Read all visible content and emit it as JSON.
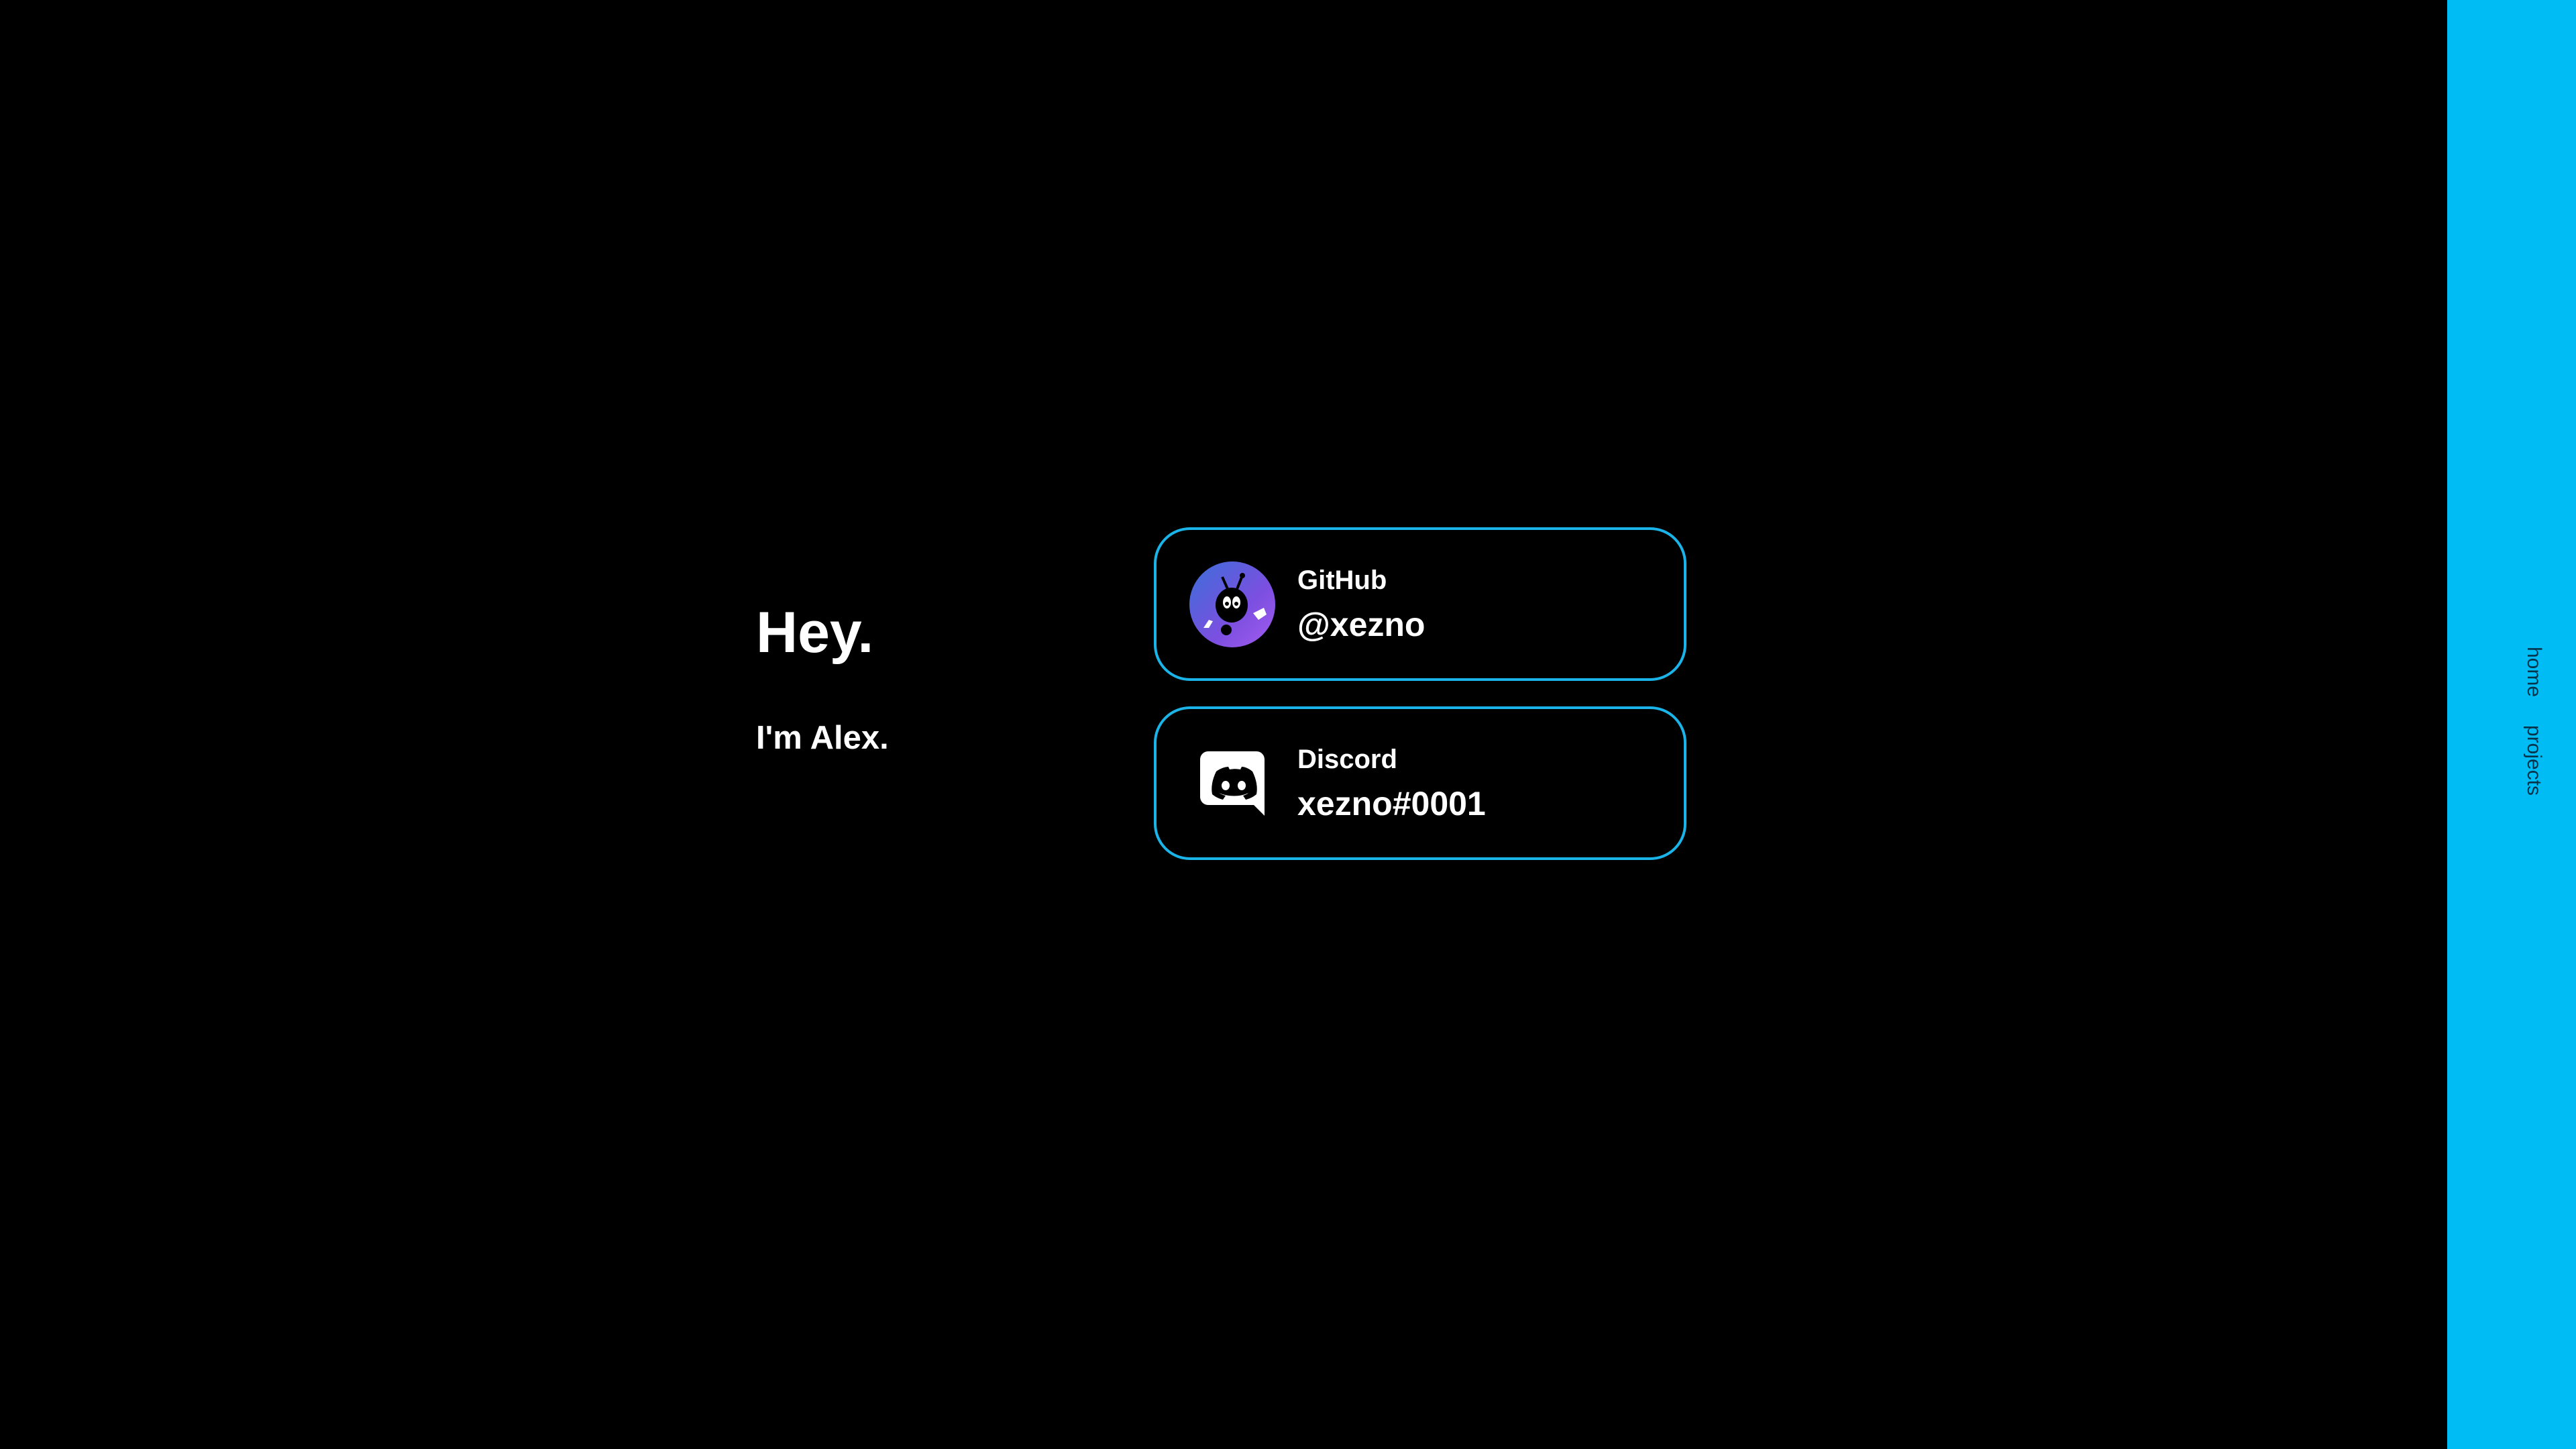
{
  "intro": {
    "heading": "Hey.",
    "subheading": "I'm Alex."
  },
  "cards": {
    "github": {
      "label": "GitHub",
      "value": "@xezno",
      "icon": "github-avatar-icon"
    },
    "discord": {
      "label": "Discord",
      "value": "xezno#0001",
      "icon": "discord-icon"
    }
  },
  "sidebar": {
    "nav": [
      {
        "label": "home"
      },
      {
        "label": "projects"
      }
    ]
  },
  "colors": {
    "background": "#000000",
    "accent": "#1ab4e8",
    "sidebar": "#00bcf5",
    "text": "#ffffff"
  }
}
